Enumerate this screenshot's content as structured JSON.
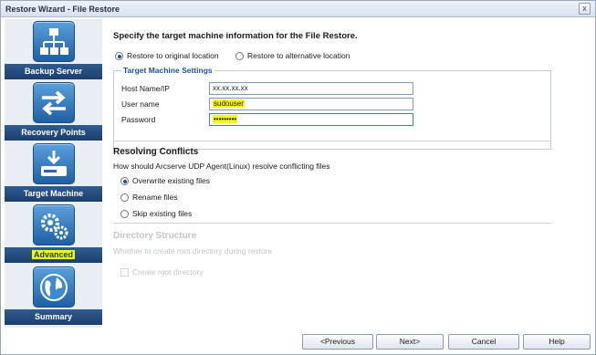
{
  "window": {
    "title": "Restore Wizard - File Restore",
    "close_glyph": "x"
  },
  "sidebar": {
    "steps": [
      {
        "label": "Backup Server",
        "icon": "server-network-icon"
      },
      {
        "label": "Recovery Points",
        "icon": "exchange-arrows-icon"
      },
      {
        "label": "Target Machine",
        "icon": "download-drive-icon"
      },
      {
        "label": "Advanced",
        "icon": "gears-icon",
        "highlighted": true
      },
      {
        "label": "Summary",
        "icon": "globe-icon"
      }
    ]
  },
  "main": {
    "heading": "Specify the target machine information for the File Restore.",
    "location_options": [
      {
        "label": "Restore to original location",
        "selected": true
      },
      {
        "label": "Restore to alternative location",
        "selected": false
      }
    ],
    "target_settings": {
      "legend": "Target Machine Settings",
      "host_label": "Host Name/IP",
      "host_value": "xx.xx.xx.xx",
      "user_label": "User name",
      "user_value": "sudouser",
      "password_label": "Password",
      "password_value": "•••••••••"
    },
    "conflicts": {
      "title": "Resolving Conflicts",
      "subtitle": "How should Arcserve UDP Agent(Linux) resolve conflicting files",
      "options": [
        {
          "label": "Overwrite existing files",
          "selected": true
        },
        {
          "label": "Rename files",
          "selected": false
        },
        {
          "label": "Skip existing files",
          "selected": false
        }
      ]
    },
    "directory": {
      "title": "Directory Structure",
      "subtitle": "Whether to create root directory during restore",
      "checkbox_label": "Create root directory"
    }
  },
  "footer": {
    "previous": "<Previous",
    "next": "Next>",
    "cancel": "Cancel",
    "help": "Help"
  },
  "colors": {
    "sidebar_label_bg": "#1c3f6c",
    "highlight": "#f5f51c",
    "accent": "#1f4f96"
  }
}
